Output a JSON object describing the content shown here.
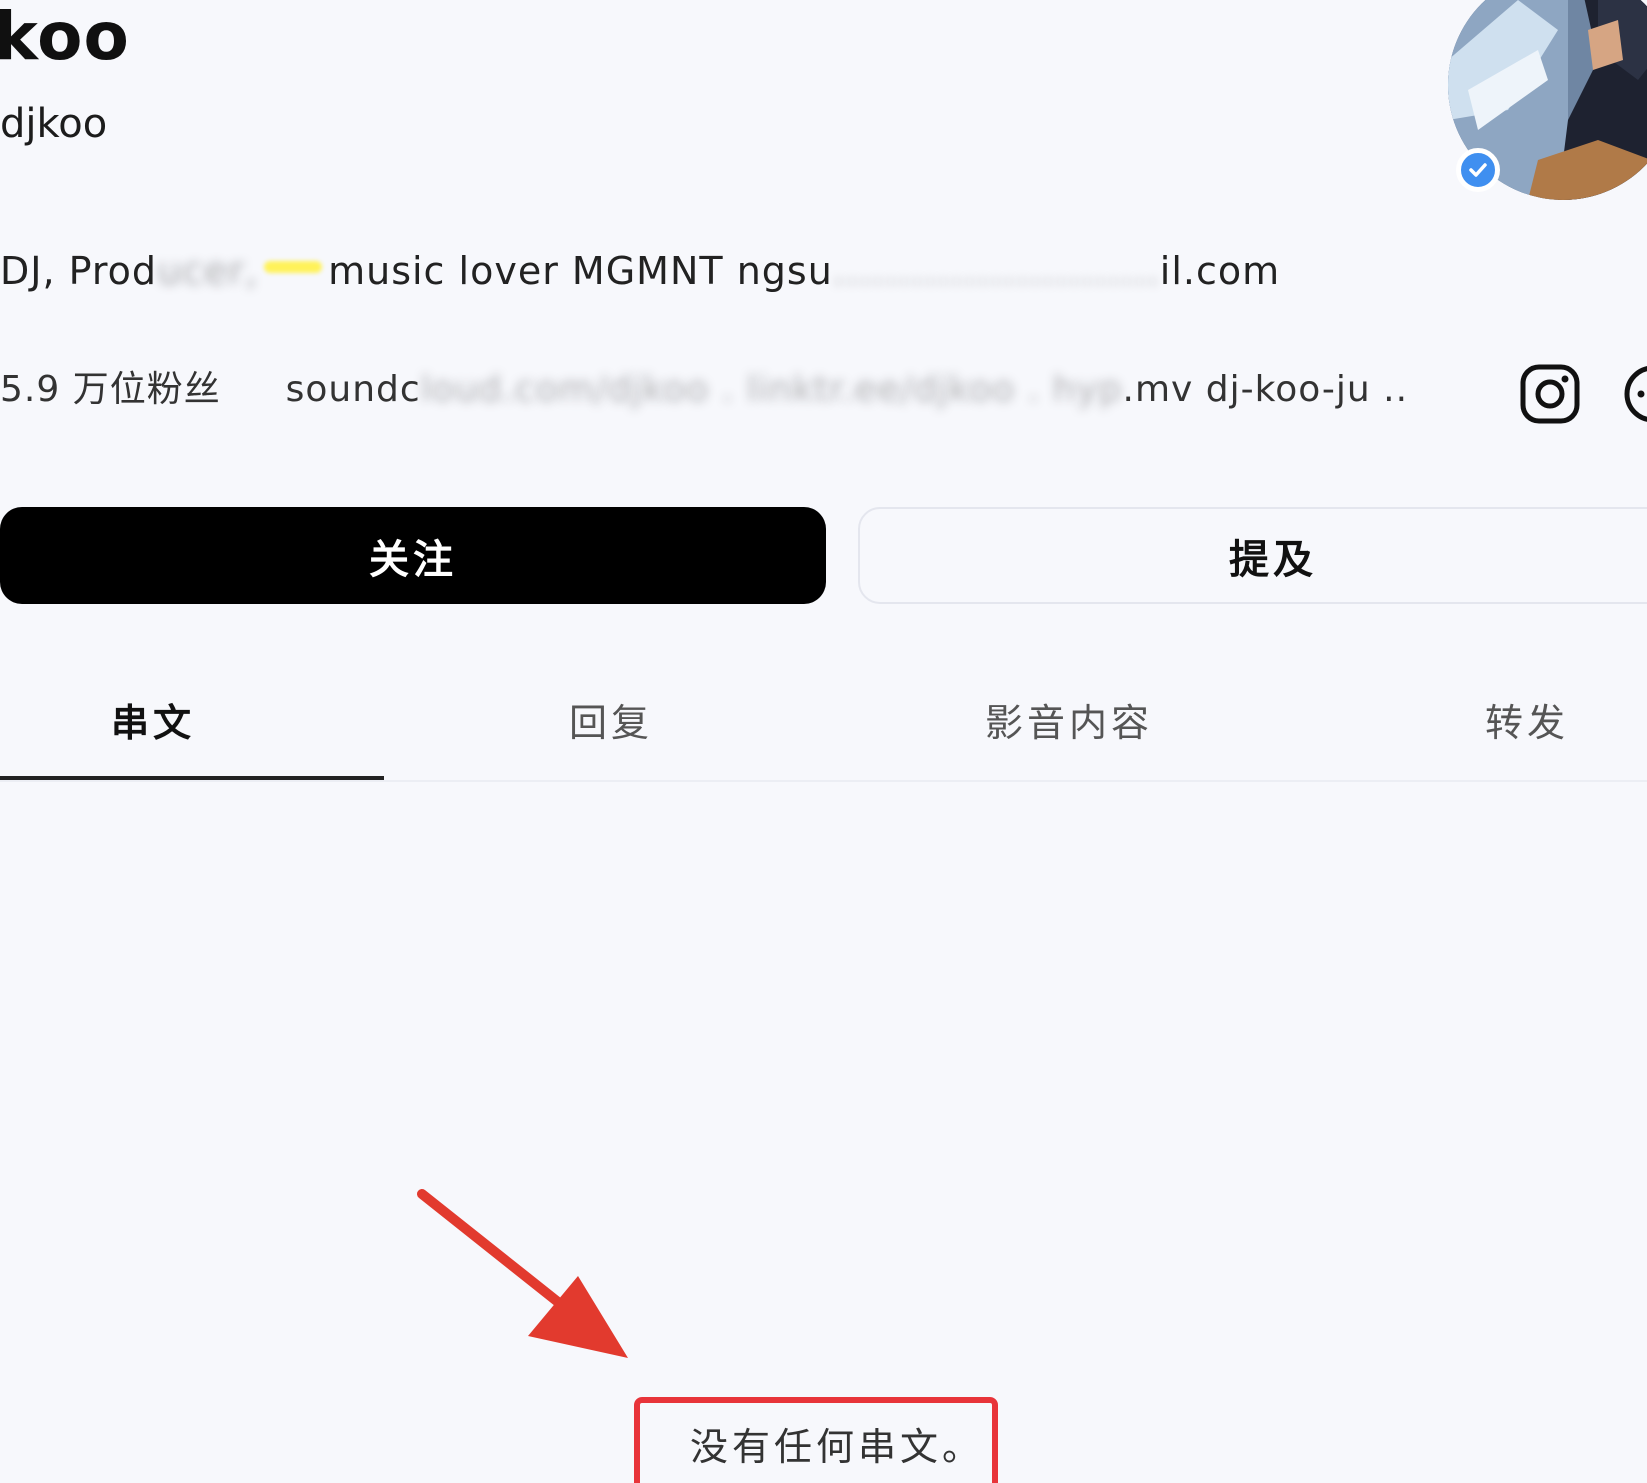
{
  "profile": {
    "display_name": "koo",
    "username": "djkoo",
    "bio": {
      "start": "DJ, Prod",
      "middle_fragments": [
        "music",
        "lover MGMNT",
        "ngsu"
      ],
      "end": "il.com"
    },
    "followers": "5.9 万位粉丝",
    "link_start": "soundc",
    "link_end": ".mv dj-koo-ju .."
  },
  "icons": {
    "instagram": "instagram-icon",
    "more": "more-icon",
    "verified": "verified-badge-icon"
  },
  "actions": {
    "follow_label": "关注",
    "mention_label": "提及"
  },
  "tabs": [
    {
      "label": "串文",
      "active": true
    },
    {
      "label": "回复",
      "active": false
    },
    {
      "label": "影音内容",
      "active": false
    },
    {
      "label": "转发",
      "active": false
    }
  ],
  "empty_state": {
    "text": "没有任何串文。"
  },
  "colors": {
    "background": "#f7f8fc",
    "follow_button": "#000000",
    "verified": "#3f8ff0",
    "annotation_red": "#e8343a"
  }
}
